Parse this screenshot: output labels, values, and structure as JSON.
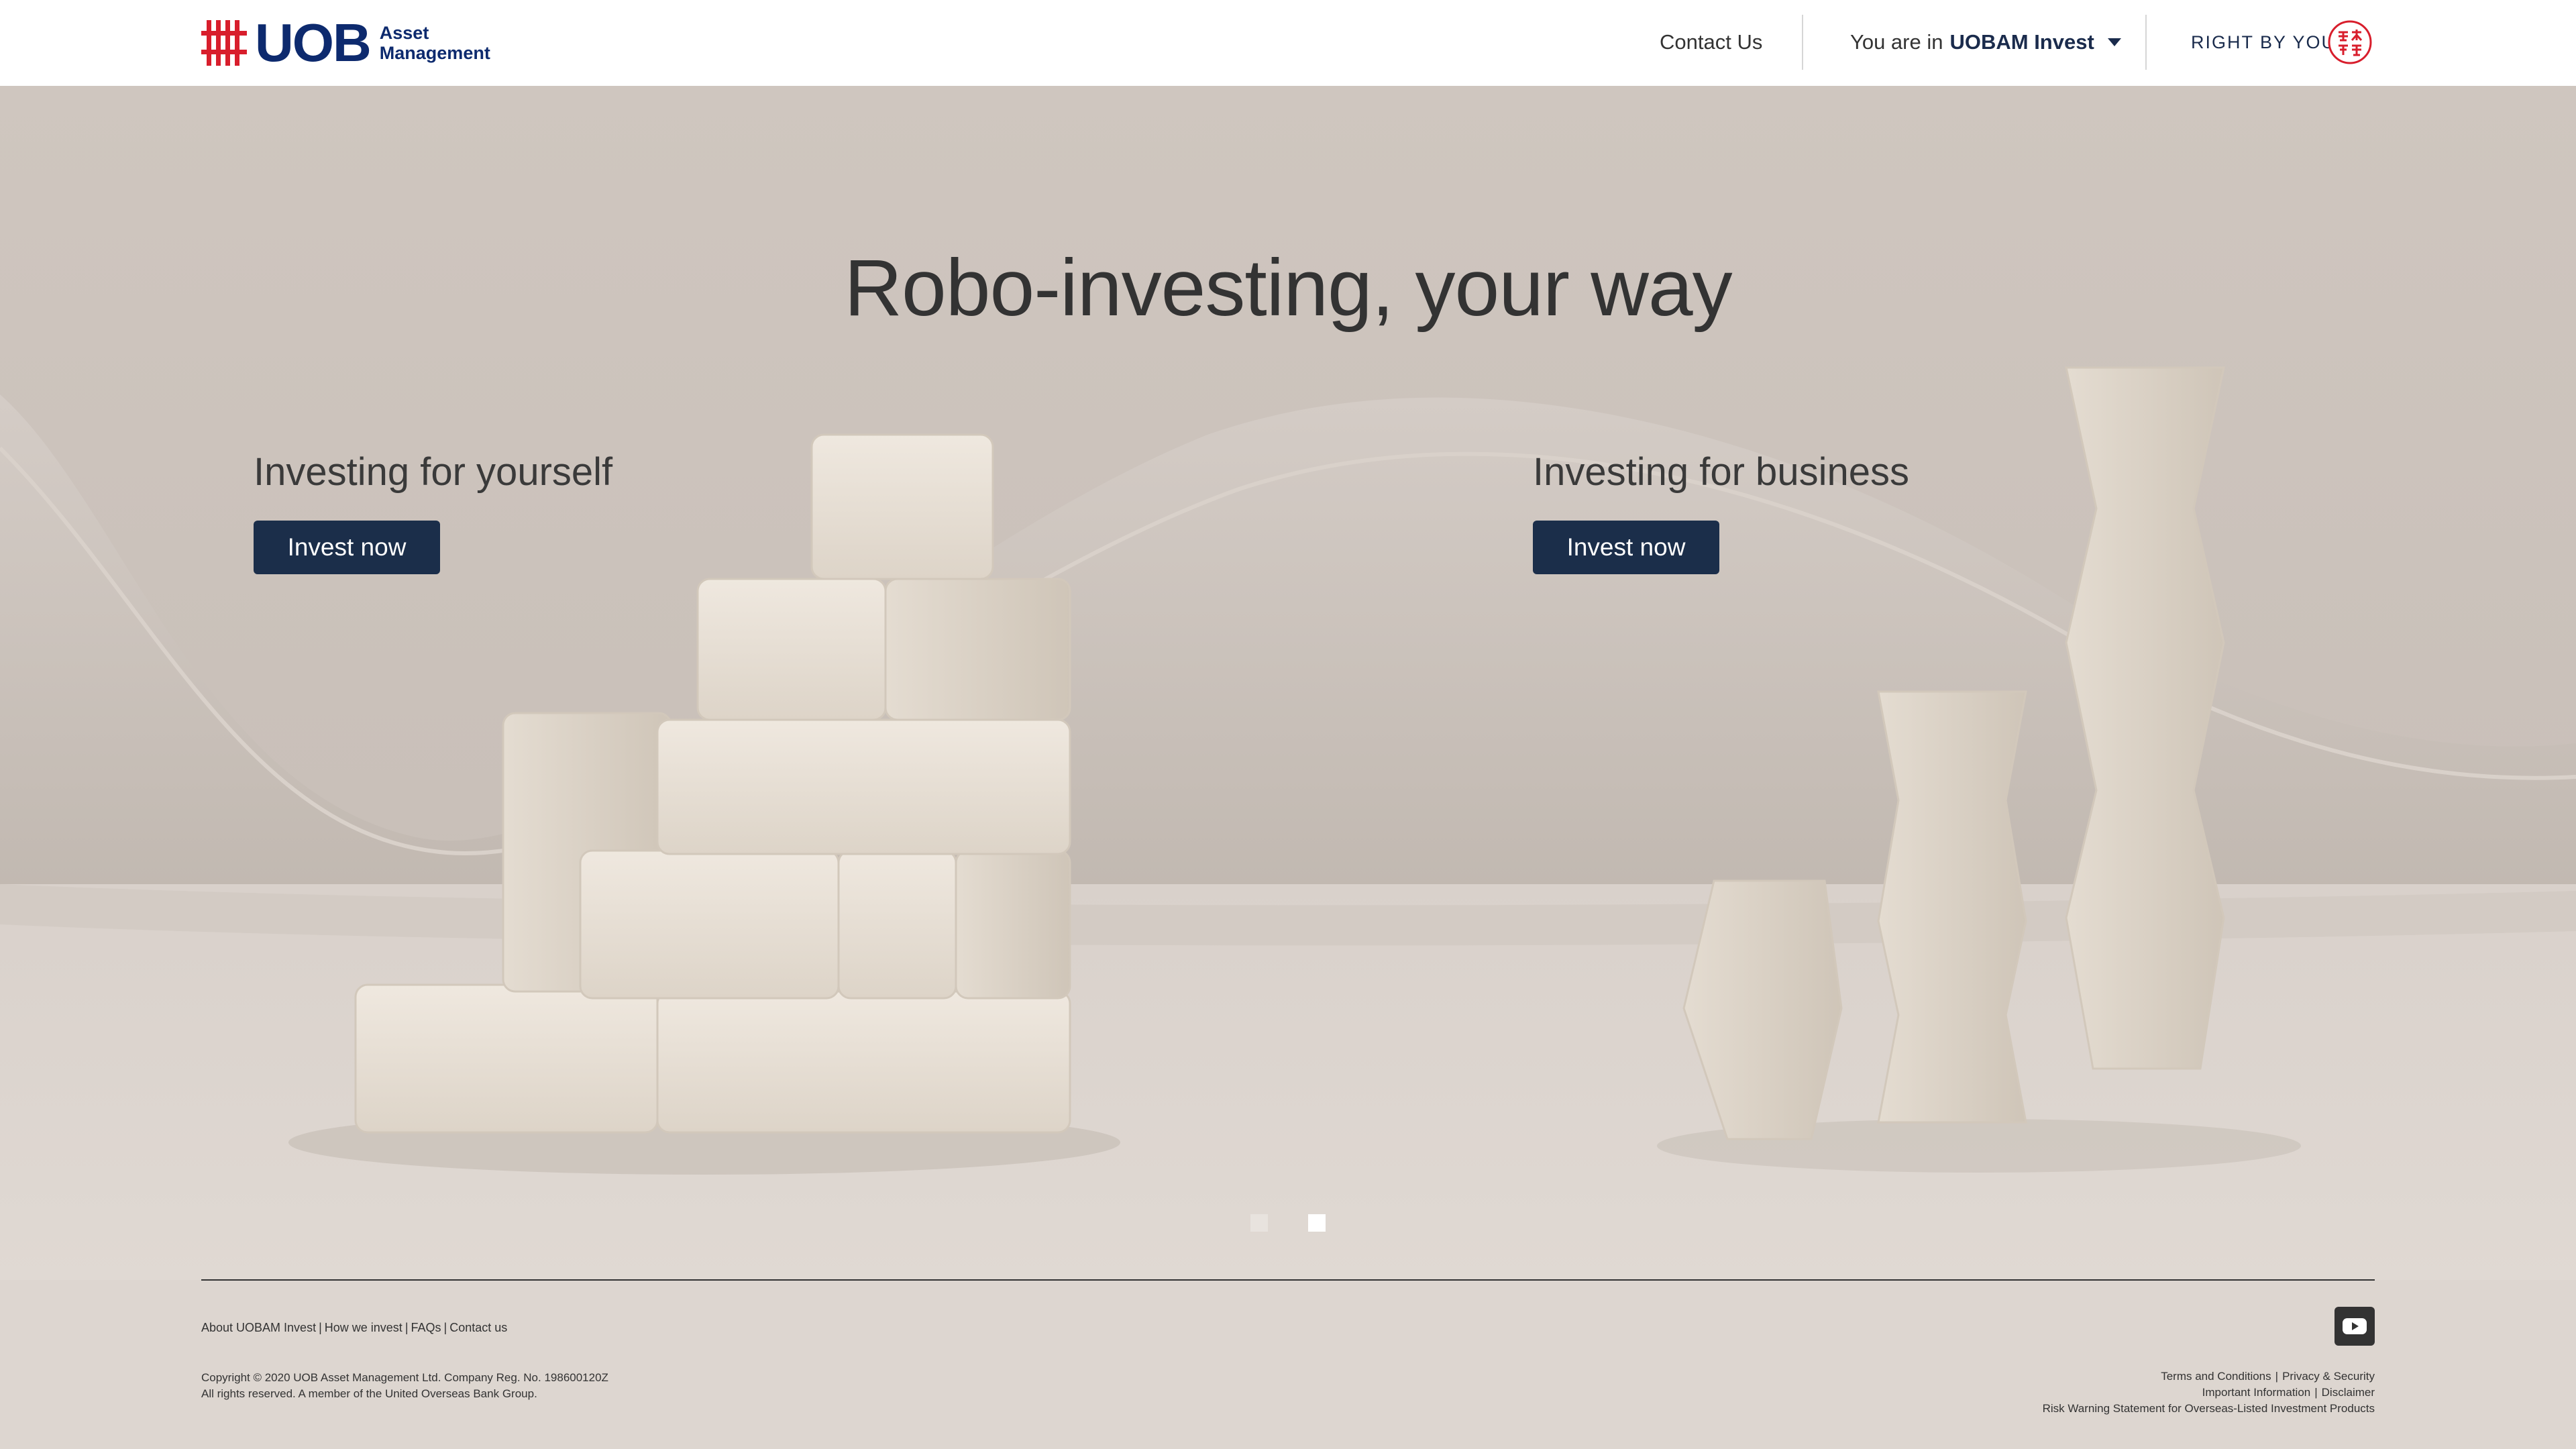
{
  "header": {
    "logo": {
      "brand": "UOB",
      "sub_line1": "Asset",
      "sub_line2": "Management"
    },
    "contact_label": "Contact Us",
    "location_prefix": "You are in",
    "location_value": "UOBAM Invest",
    "tagline": "RIGHT BY YOU",
    "seal_icon": "uob-seal-icon"
  },
  "hero": {
    "title": "Robo-investing, your way",
    "panels": [
      {
        "heading": "Investing for yourself",
        "button_label": "Invest now"
      },
      {
        "heading": "Investing for business",
        "button_label": "Invest now"
      }
    ],
    "carousel": {
      "slides": 2,
      "active_index": 1
    }
  },
  "footer": {
    "links": [
      "About UOBAM Invest",
      "How we invest",
      "FAQs",
      "Contact us"
    ],
    "copyright_line1": "Copyright © 2020 UOB Asset Management Ltd. Company Reg. No. 198600120Z",
    "copyright_line2": "All rights reserved. A member of the United Overseas Bank Group.",
    "legal": {
      "terms": "Terms and Conditions",
      "privacy": "Privacy & Security",
      "important": "Important Information",
      "disclaimer": "Disclaimer",
      "risk": "Risk Warning Statement for Overseas-Listed Investment Products"
    },
    "social_icon": "youtube-icon"
  },
  "colors": {
    "brand_navy": "#0d2a6e",
    "brand_red": "#d81e2c",
    "button_navy": "#1b2e4a",
    "page_bg": "#ddd6d0"
  }
}
